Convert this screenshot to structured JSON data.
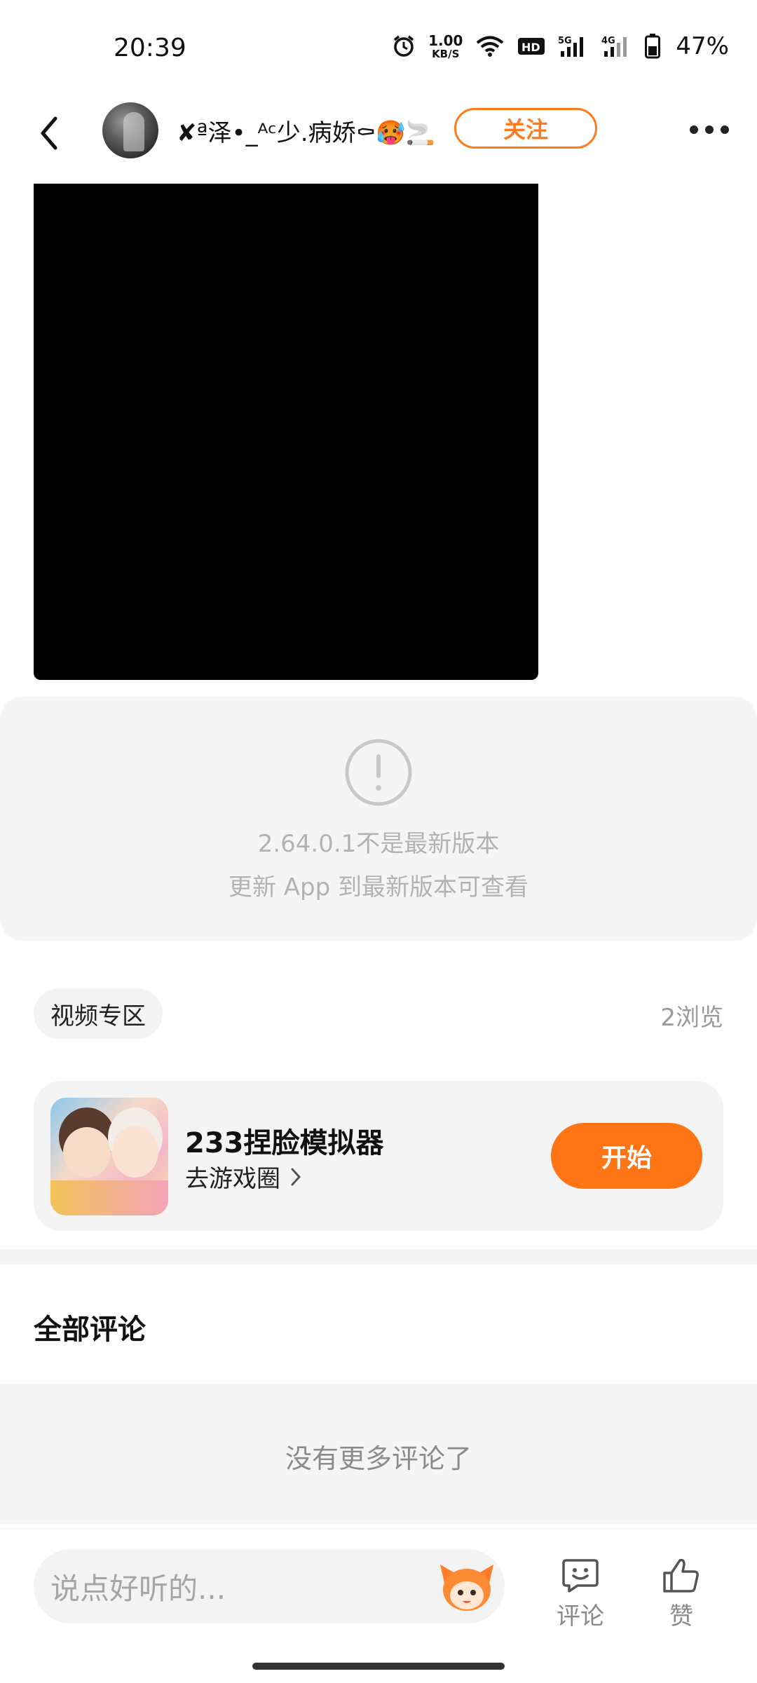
{
  "status_bar": {
    "time": "20:39",
    "speed_value": "1.00",
    "speed_unit": "KB/S",
    "network_tags": [
      "HD",
      "5G",
      "4G"
    ],
    "battery": "47%",
    "icons": [
      "alarm-icon",
      "wifi-icon",
      "hd-icon",
      "signal-5g-icon",
      "signal-4g-icon",
      "battery-icon"
    ]
  },
  "header": {
    "username": "✘ª泽•_ᴬᶜ少.病娇⚰🥵🚬",
    "follow_label": "关注",
    "icons": [
      "back-arrow-icon",
      "more-dots-icon"
    ]
  },
  "notice": {
    "line1": "2.64.0.1不是最新版本",
    "line2": "更新 App 到最新版本可查看",
    "icon": "exclamation-circle-icon"
  },
  "post_meta": {
    "section_label": "视频专区",
    "views": "2浏览"
  },
  "game_card": {
    "title": "233捏脸模拟器",
    "subtitle": "去游戏圈",
    "start_label": "开始"
  },
  "comments": {
    "title": "全部评论",
    "empty_text": "没有更多评论了"
  },
  "bottom_bar": {
    "input_placeholder": "说点好听的...",
    "comment_label": "评论",
    "like_label": "赞"
  },
  "colors": {
    "accent": "#ff7414",
    "follow_border": "#ff7a1a",
    "muted_text": "#b3b3b3",
    "panel_bg": "#f5f5f5"
  }
}
